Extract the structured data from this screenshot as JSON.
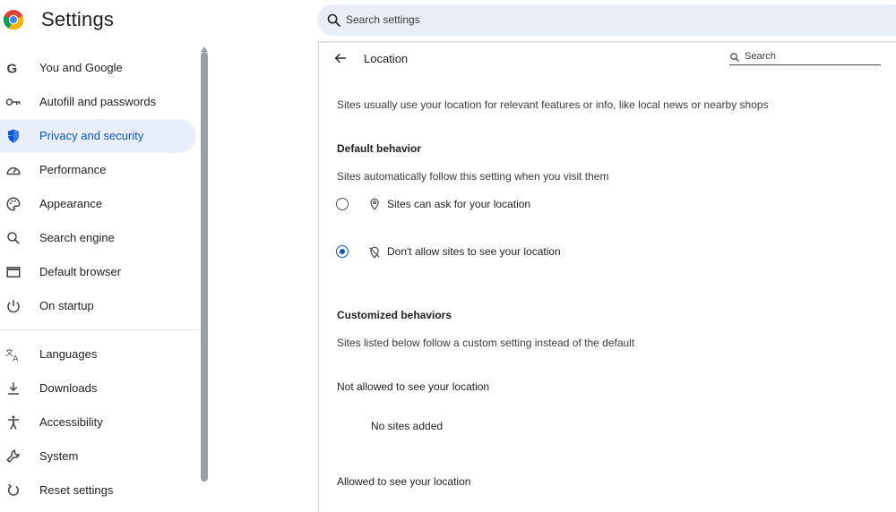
{
  "header": {
    "title": "Settings",
    "search_placeholder": "Search settings"
  },
  "sidebar": {
    "items": [
      {
        "label": "You and Google",
        "icon": "google-g-icon"
      },
      {
        "label": "Autofill and passwords",
        "icon": "key-icon"
      },
      {
        "label": "Privacy and security",
        "icon": "shield-icon",
        "active": true
      },
      {
        "label": "Performance",
        "icon": "speedometer-icon"
      },
      {
        "label": "Appearance",
        "icon": "palette-icon"
      },
      {
        "label": "Search engine",
        "icon": "search-icon"
      },
      {
        "label": "Default browser",
        "icon": "browser-window-icon"
      },
      {
        "label": "On startup",
        "icon": "power-icon"
      },
      {
        "label": "Languages",
        "icon": "translate-icon"
      },
      {
        "label": "Downloads",
        "icon": "download-icon"
      },
      {
        "label": "Accessibility",
        "icon": "accessibility-icon"
      },
      {
        "label": "System",
        "icon": "wrench-icon"
      },
      {
        "label": "Reset settings",
        "icon": "reset-icon"
      }
    ]
  },
  "main": {
    "title": "Location",
    "search_placeholder": "Search",
    "description": "Sites usually use your location for relevant features or info, like local news or nearby shops",
    "default_behavior": {
      "heading": "Default behavior",
      "subtext": "Sites automatically follow this setting when you visit them",
      "options": [
        {
          "label": "Sites can ask for your location",
          "icon": "location-pin-icon",
          "checked": false
        },
        {
          "label": "Don't allow sites to see your location",
          "icon": "location-off-icon",
          "checked": true
        }
      ]
    },
    "customized": {
      "heading": "Customized behaviors",
      "subtext": "Sites listed below follow a custom setting instead of the default",
      "not_allowed_heading": "Not allowed to see your location",
      "not_allowed_empty": "No sites added",
      "allowed_heading": "Allowed to see your location"
    }
  },
  "colors": {
    "accent": "#0b57d0",
    "active_bg": "#e8eefb",
    "search_bg": "#e9eef6"
  }
}
